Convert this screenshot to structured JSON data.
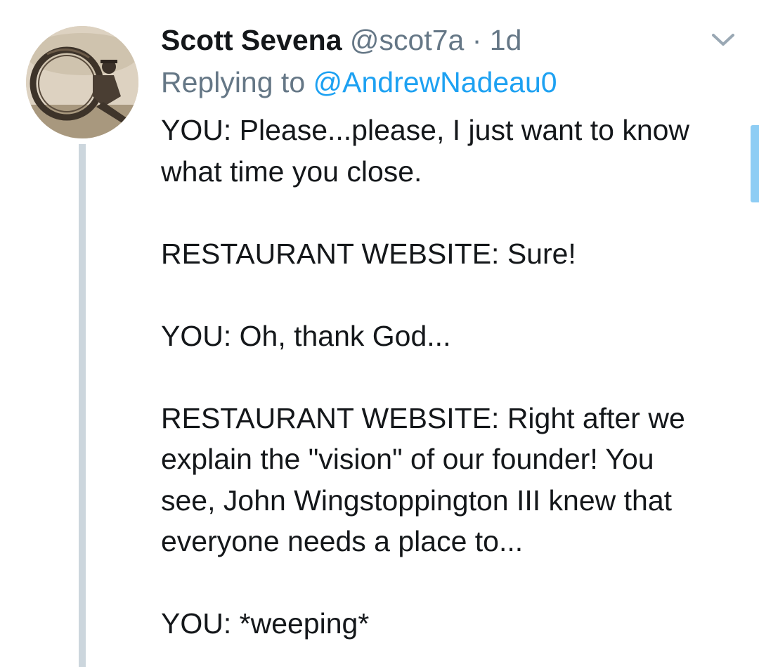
{
  "tweet": {
    "author_name": "Scott Sevena",
    "author_handle": "@scot7a",
    "separator": "·",
    "timestamp": "1d",
    "reply_prefix": "Replying to",
    "reply_to": "@AndrewNadeau0",
    "lines": [
      "YOU: Please...please, I just want to know",
      "what time you close.",
      "",
      "RESTAURANT WEBSITE: Sure!",
      "",
      "YOU: Oh, thank God...",
      "",
      "RESTAURANT WEBSITE: Right after we",
      "explain the \"vision\" of our founder! You",
      "see, John Wingstoppington III knew that",
      "everyone needs a place to...",
      "",
      "YOU: *weeping*"
    ]
  },
  "icons": {
    "menu": "chevron-down-icon",
    "avatar": "avatar-image"
  },
  "colors": {
    "name": "#14171a",
    "secondary": "#657786",
    "link": "#1da1f2",
    "thread_line": "#ccd6dd",
    "scroll_indicator": "#8ecdf4"
  }
}
